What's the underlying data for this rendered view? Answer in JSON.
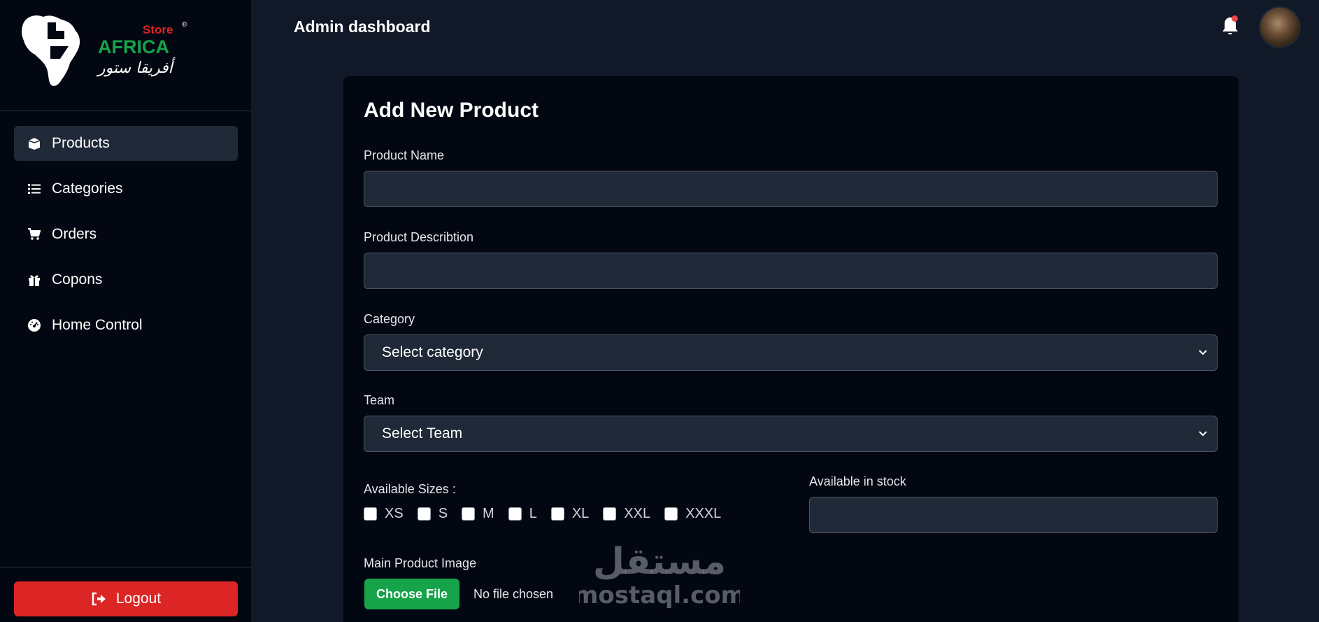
{
  "sidebar": {
    "logo": {
      "top_text": "Store",
      "main_text": "AFRICA",
      "arabic_text": "أفريقا ستور"
    },
    "items": [
      {
        "label": "Products",
        "icon": "box-icon",
        "active": true
      },
      {
        "label": "Categories",
        "icon": "list-icon",
        "active": false
      },
      {
        "label": "Orders",
        "icon": "cart-icon",
        "active": false
      },
      {
        "label": "Copons",
        "icon": "gift-icon",
        "active": false
      },
      {
        "label": "Home Control",
        "icon": "gauge-icon",
        "active": false
      }
    ],
    "logout_label": "Logout"
  },
  "header": {
    "title": "Admin dashboard"
  },
  "form": {
    "title": "Add New Product",
    "product_name_label": "Product Name",
    "product_name_value": "",
    "description_label": "Product Describtion",
    "description_value": "",
    "category_label": "Category",
    "category_selected": "Select category",
    "team_label": "Team",
    "team_selected": "Select Team",
    "sizes_label": "Available Sizes :",
    "sizes": [
      "XS",
      "S",
      "M",
      "L",
      "XL",
      "XXL",
      "XXXL"
    ],
    "stock_label": "Available in stock",
    "stock_value": "",
    "image_label": "Main Product Image",
    "choose_file_label": "Choose File",
    "no_file_text": "No file chosen"
  },
  "watermark": {
    "arabic": "مستقل",
    "latin": "mostaql.com"
  },
  "colors": {
    "accent_red": "#dc2626",
    "accent_green": "#16a34a",
    "panel": "#030712",
    "background": "#111827",
    "input": "#1f2937"
  }
}
